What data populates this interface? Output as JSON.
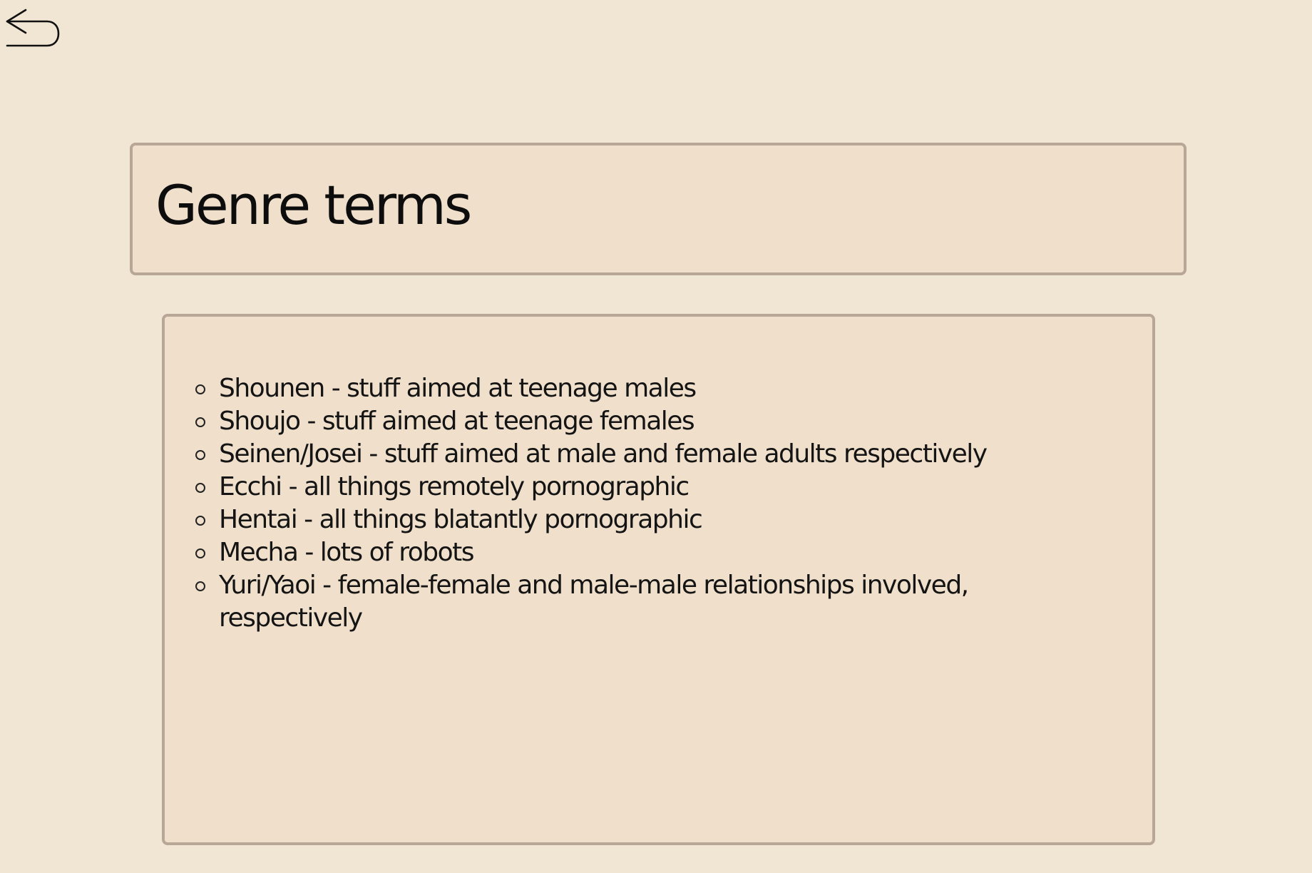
{
  "navigation": {
    "back_icon": "undo-arrow-icon"
  },
  "header": {
    "title": "Genre terms"
  },
  "main": {
    "terms": [
      "Shounen - stuff aimed at teenage males",
      "Shoujo - stuff aimed at teenage females",
      "Seinen/Josei - stuff aimed at male and female adults respectively",
      "Ecchi - all things remotely pornographic",
      "Hentai - all things blatantly pornographic",
      "Mecha - lots of robots",
      "Yuri/Yaoi - female-female and male-male relationships involved, respectively"
    ]
  },
  "colors": {
    "background": "#f1e5d3",
    "card_background": "#f0e0cb",
    "card_border": "#b8a797",
    "text": "#111111"
  }
}
